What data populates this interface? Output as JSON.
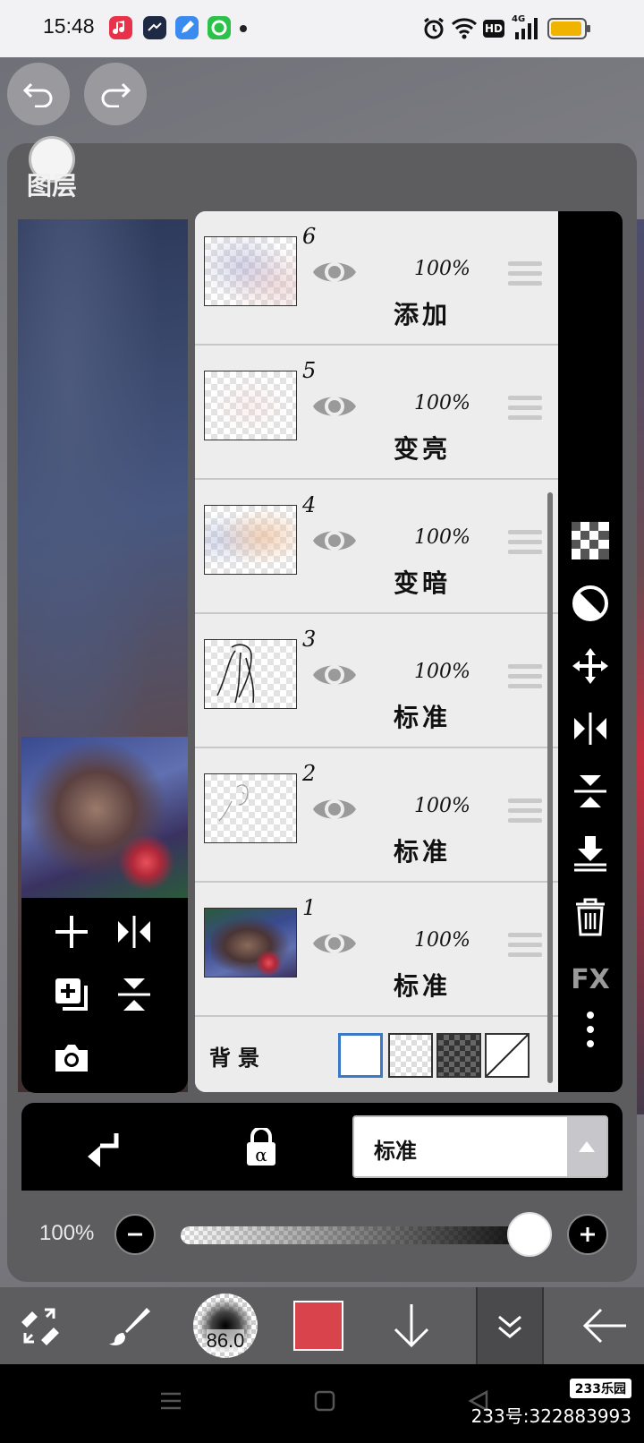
{
  "status_bar": {
    "time": "15:48",
    "indicators": [
      "alarm-icon",
      "wifi-icon",
      "hd-icon",
      "4g-signal-icon",
      "battery-icon"
    ],
    "hd": "HD",
    "network": "4G"
  },
  "panel": {
    "title": "图层"
  },
  "layers": [
    {
      "number": "6",
      "opacity": "100%",
      "mode": "添加"
    },
    {
      "number": "5",
      "opacity": "100%",
      "mode": "变亮"
    },
    {
      "number": "4",
      "opacity": "100%",
      "mode": "变暗"
    },
    {
      "number": "3",
      "opacity": "100%",
      "mode": "标准"
    },
    {
      "number": "2",
      "opacity": "100%",
      "mode": "标准"
    },
    {
      "number": "1",
      "opacity": "100%",
      "mode": "标准"
    }
  ],
  "background": {
    "label": "背景"
  },
  "right_tools": {
    "fx_label": "FX"
  },
  "blend": {
    "mode": "标准"
  },
  "opacity": {
    "label": "100%",
    "value": 1.0
  },
  "bottom_bar": {
    "brush_size": "86.0",
    "color": "#d9444c"
  },
  "watermark": {
    "logo": "233乐园",
    "id": "233号:322883993"
  }
}
